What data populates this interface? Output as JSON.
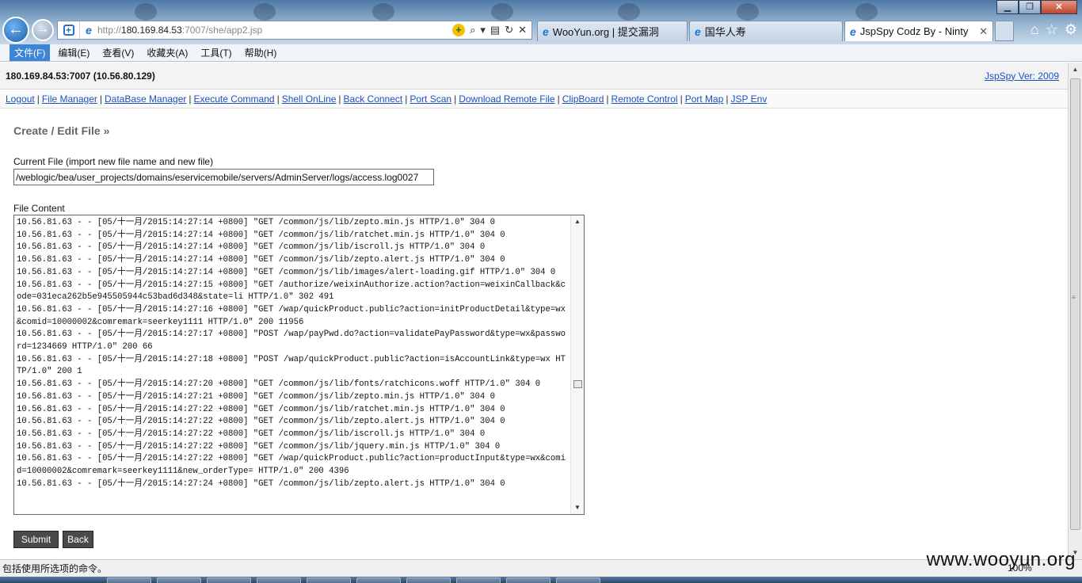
{
  "browser": {
    "address_prefix": "http://",
    "address_host": "180.169.84.53",
    "address_rest": ":7007/she/app2.jsp",
    "tabs": [
      {
        "label": "WooYun.org | 提交漏洞",
        "active": false
      },
      {
        "label": "国华人寿",
        "active": false
      },
      {
        "label": "JspSpy Codz By - Ninty",
        "active": true
      }
    ],
    "tab_close_glyph": "✕",
    "menu": [
      "文件(F)",
      "编辑(E)",
      "查看(V)",
      "收藏夹(A)",
      "工具(T)",
      "帮助(H)"
    ],
    "status_text": "包括使用所选项的命令。",
    "zoom": "100%",
    "watermark": "www.wooyun.org",
    "icons": [
      "back-arrow-icon",
      "forward-arrow-icon",
      "shield-icon",
      "ie-icon",
      "search-icon",
      "refresh-icon",
      "stop-icon",
      "home-icon",
      "favorites-star-icon",
      "gear-icon"
    ]
  },
  "page": {
    "host_info": "180.169.84.53:7007 (10.56.80.129)",
    "version_link": "JspSpy Ver: 2009",
    "nav_links": [
      "Logout",
      "File Manager",
      "DataBase Manager",
      "Execute Command",
      "Shell OnLine",
      "Back Connect",
      "Port Scan",
      "Download Remote File",
      "ClipBoard",
      "Remote Control",
      "Port Map",
      "JSP Env"
    ],
    "section_title": "Create / Edit File »",
    "current_file_label": "Current File (import new file name and new file)",
    "current_file_value": "/weblogic/bea/user_projects/domains/eservicemobile/servers/AdminServer/logs/access.log0027",
    "file_content_label": "File Content",
    "file_content": "10.56.81.63 - - [05/十一月/2015:14:27:14 +0800] \"GET /common/js/lib/zepto.min.js HTTP/1.0\" 304 0\n10.56.81.63 - - [05/十一月/2015:14:27:14 +0800] \"GET /common/js/lib/ratchet.min.js HTTP/1.0\" 304 0\n10.56.81.63 - - [05/十一月/2015:14:27:14 +0800] \"GET /common/js/lib/iscroll.js HTTP/1.0\" 304 0\n10.56.81.63 - - [05/十一月/2015:14:27:14 +0800] \"GET /common/js/lib/zepto.alert.js HTTP/1.0\" 304 0\n10.56.81.63 - - [05/十一月/2015:14:27:14 +0800] \"GET /common/js/lib/images/alert-loading.gif HTTP/1.0\" 304 0\n10.56.81.63 - - [05/十一月/2015:14:27:15 +0800] \"GET /authorize/weixinAuthorize.action?action=weixinCallback&code=031eca262b5e945505944c53bad6d348&state=li HTTP/1.0\" 302 491\n10.56.81.63 - - [05/十一月/2015:14:27:16 +0800] \"GET /wap/quickProduct.public?action=initProductDetail&type=wx&comid=10000002&comremark=seerkey1111 HTTP/1.0\" 200 11956\n10.56.81.63 - - [05/十一月/2015:14:27:17 +0800] \"POST /wap/payPwd.do?action=validatePayPassword&type=wx&password=1234669 HTTP/1.0\" 200 66\n10.56.81.63 - - [05/十一月/2015:14:27:18 +0800] \"POST /wap/quickProduct.public?action=isAccountLink&type=wx HTTP/1.0\" 200 1\n10.56.81.63 - - [05/十一月/2015:14:27:20 +0800] \"GET /common/js/lib/fonts/ratchicons.woff HTTP/1.0\" 304 0\n10.56.81.63 - - [05/十一月/2015:14:27:21 +0800] \"GET /common/js/lib/zepto.min.js HTTP/1.0\" 304 0\n10.56.81.63 - - [05/十一月/2015:14:27:22 +0800] \"GET /common/js/lib/ratchet.min.js HTTP/1.0\" 304 0\n10.56.81.63 - - [05/十一月/2015:14:27:22 +0800] \"GET /common/js/lib/zepto.alert.js HTTP/1.0\" 304 0\n10.56.81.63 - - [05/十一月/2015:14:27:22 +0800] \"GET /common/js/lib/iscroll.js HTTP/1.0\" 304 0\n10.56.81.63 - - [05/十一月/2015:14:27:22 +0800] \"GET /common/js/lib/jquery.min.js HTTP/1.0\" 304 0\n10.56.81.63 - - [05/十一月/2015:14:27:22 +0800] \"GET /wap/quickProduct.public?action=productInput&type=wx&comid=10000002&comremark=seerkey1111&new_orderType= HTTP/1.0\" 200 4396\n10.56.81.63 - - [05/十一月/2015:14:27:24 +0800] \"GET /common/js/lib/zepto.alert.js HTTP/1.0\" 304 0",
    "submit_label": "Submit",
    "back_label": "Back"
  }
}
